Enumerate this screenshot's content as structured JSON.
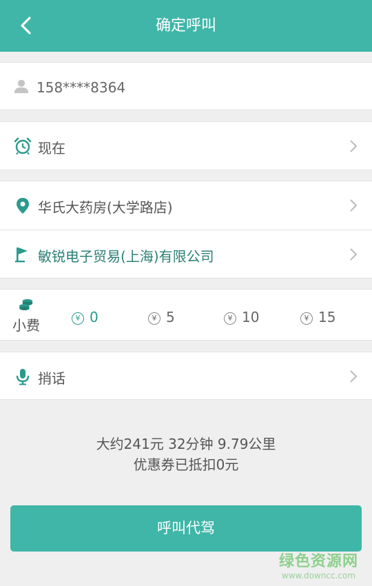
{
  "header": {
    "title": "确定呼叫"
  },
  "user": {
    "phone": "158****8364"
  },
  "time": {
    "label": "现在"
  },
  "route": {
    "start": "华氏大药房(大学路店)",
    "destination": "敏锐电子贸易(上海)有限公司"
  },
  "tip": {
    "label": "小费",
    "currency_symbol": "¥",
    "options": [
      {
        "value": "0",
        "selected": true
      },
      {
        "value": "5",
        "selected": false
      },
      {
        "value": "10",
        "selected": false
      },
      {
        "value": "15",
        "selected": false
      }
    ]
  },
  "message": {
    "label": "捎话"
  },
  "summary": {
    "estimate": "大约241元 32分钟  9.79公里",
    "coupon": "优惠券已抵扣0元"
  },
  "actions": {
    "call_label": "呼叫代驾"
  },
  "watermark": {
    "name": "绿色资源网",
    "url": "www.downcc.com"
  },
  "colors": {
    "accent": "#3fb6a8",
    "icon_green": "#2a9a8c",
    "background": "#efefef"
  }
}
